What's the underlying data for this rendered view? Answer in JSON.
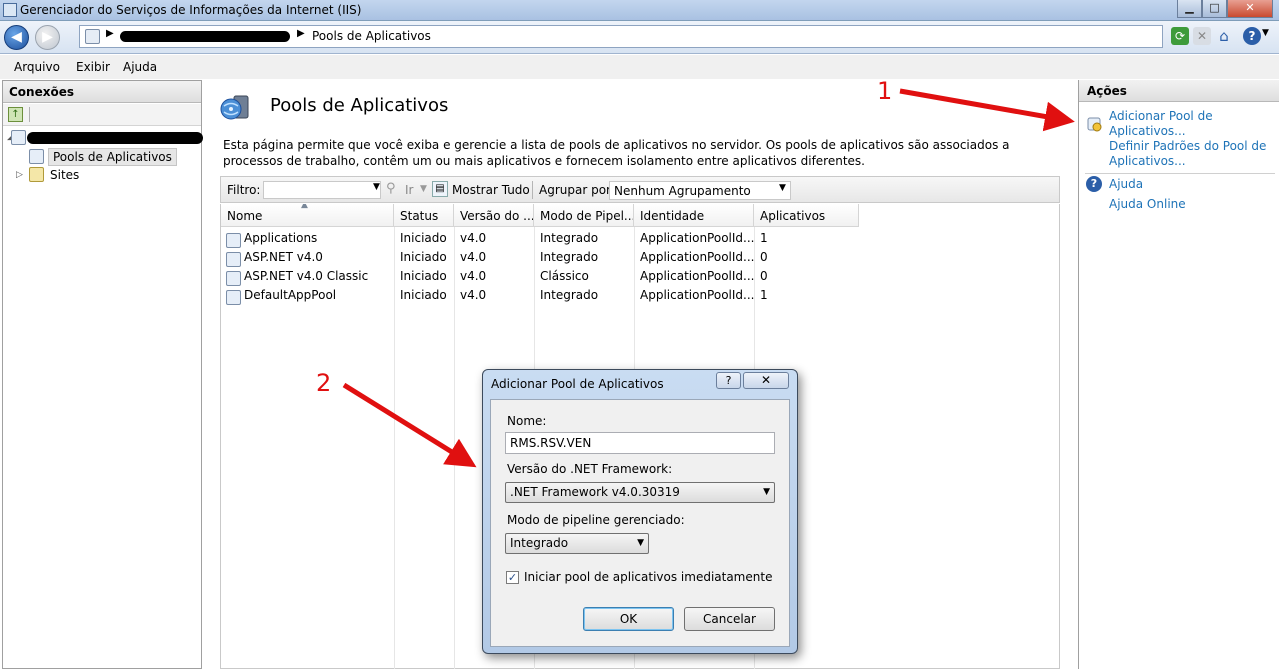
{
  "window": {
    "title": "Gerenciador do Serviços de Informações da Internet (IIS)",
    "controls": {
      "minimize": "▁",
      "maximize": "□",
      "close": "✕"
    }
  },
  "address_bar": {
    "breadcrumb_current": "Pools de Aplicativos",
    "icons": [
      "back-arrow-icon",
      "forward-arrow-icon",
      "refresh-icon",
      "stop-icon",
      "home-icon",
      "help-icon"
    ]
  },
  "menu": {
    "items": [
      "Arquivo",
      "Exibir",
      "Ajuda"
    ]
  },
  "connections": {
    "header": "Conexões",
    "tree": {
      "pools": "Pools de Aplicativos",
      "sites": "Sites"
    }
  },
  "main": {
    "title": "Pools de Aplicativos",
    "description": "Esta página permite que você exiba e gerencie a lista de pools de aplicativos no servidor. Os pools de aplicativos são associados a processos de trabalho, contêm um ou mais aplicativos e fornecem isolamento entre aplicativos diferentes.",
    "filter": {
      "label": "Filtro:",
      "go": "Ir",
      "show_all": "Mostrar Tudo",
      "group_by_label": "Agrupar por:",
      "group_by_value": "Nenhum Agrupamento"
    },
    "table": {
      "columns": [
        "Nome",
        "Status",
        "Versão do ....",
        "Modo de Pipel...",
        "Identidade",
        "Aplicativos"
      ],
      "rows": [
        [
          "Applications",
          "Iniciado",
          "v4.0",
          "Integrado",
          "ApplicationPoolId...",
          "1"
        ],
        [
          "ASP.NET v4.0",
          "Iniciado",
          "v4.0",
          "Integrado",
          "ApplicationPoolId...",
          "0"
        ],
        [
          "ASP.NET v4.0 Classic",
          "Iniciado",
          "v4.0",
          "Clássico",
          "ApplicationPoolId...",
          "0"
        ],
        [
          "DefaultAppPool",
          "Iniciado",
          "v4.0",
          "Integrado",
          "ApplicationPoolId...",
          "1"
        ]
      ]
    }
  },
  "actions": {
    "header": "Ações",
    "add_pool": "Adicionar Pool de Aplicativos...",
    "set_defaults": "Definir Padrões do Pool de Aplicativos...",
    "help": "Ajuda",
    "help_online": "Ajuda Online"
  },
  "annotations": {
    "one": "1",
    "two": "2",
    "color": "#e01010"
  },
  "dialog": {
    "title": "Adicionar Pool de Aplicativos",
    "help_btn": "?",
    "close_btn": "✕",
    "name_label": "Nome:",
    "name_value": "RMS.RSV.VEN",
    "framework_label": "Versão do .NET Framework:",
    "framework_value": ".NET Framework v4.0.30319",
    "pipeline_label": "Modo de pipeline gerenciado:",
    "pipeline_value": "Integrado",
    "start_label": "Iniciar pool de aplicativos imediatamente",
    "start_checked": true,
    "ok": "OK",
    "cancel": "Cancelar"
  }
}
